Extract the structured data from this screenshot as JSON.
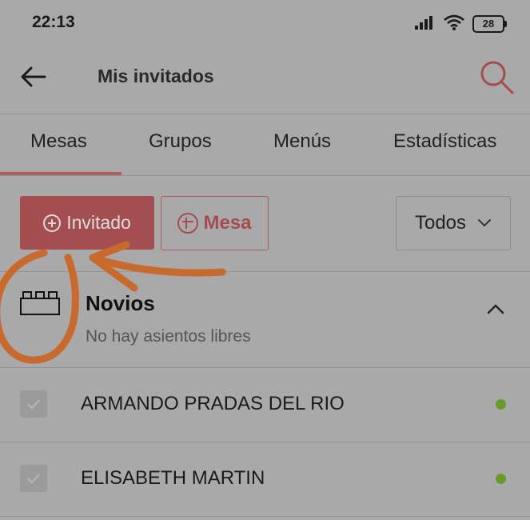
{
  "status_bar": {
    "time": "22:13",
    "battery": "28",
    "icons": [
      "signal-icon",
      "wifi-icon",
      "battery-icon"
    ]
  },
  "app_bar": {
    "title": "Mis invitados",
    "back_icon": "back-arrow-icon",
    "search_icon": "search-icon"
  },
  "tabs": [
    {
      "label": "Mesas",
      "active": true
    },
    {
      "label": "Grupos",
      "active": false
    },
    {
      "label": "Menús",
      "active": false
    },
    {
      "label": "Estadísticas",
      "active": false
    }
  ],
  "actions": {
    "add_guest_label": "Invitado",
    "add_table_label": "Mesa",
    "filter_label": "Todos"
  },
  "table": {
    "name": "Novios",
    "status": "No hay asientos libres",
    "icon": "table-icon",
    "expanded": true
  },
  "guests": [
    {
      "name": "ARMANDO PRADAS DEL RIO",
      "status_color": "#6a9a2a"
    },
    {
      "name": "ELISABETH MARTIN",
      "status_color": "#6a9a2a"
    }
  ],
  "colors": {
    "accent": "#a54e52",
    "annotation": "#c86a2e",
    "background": "#a9a9a9"
  }
}
